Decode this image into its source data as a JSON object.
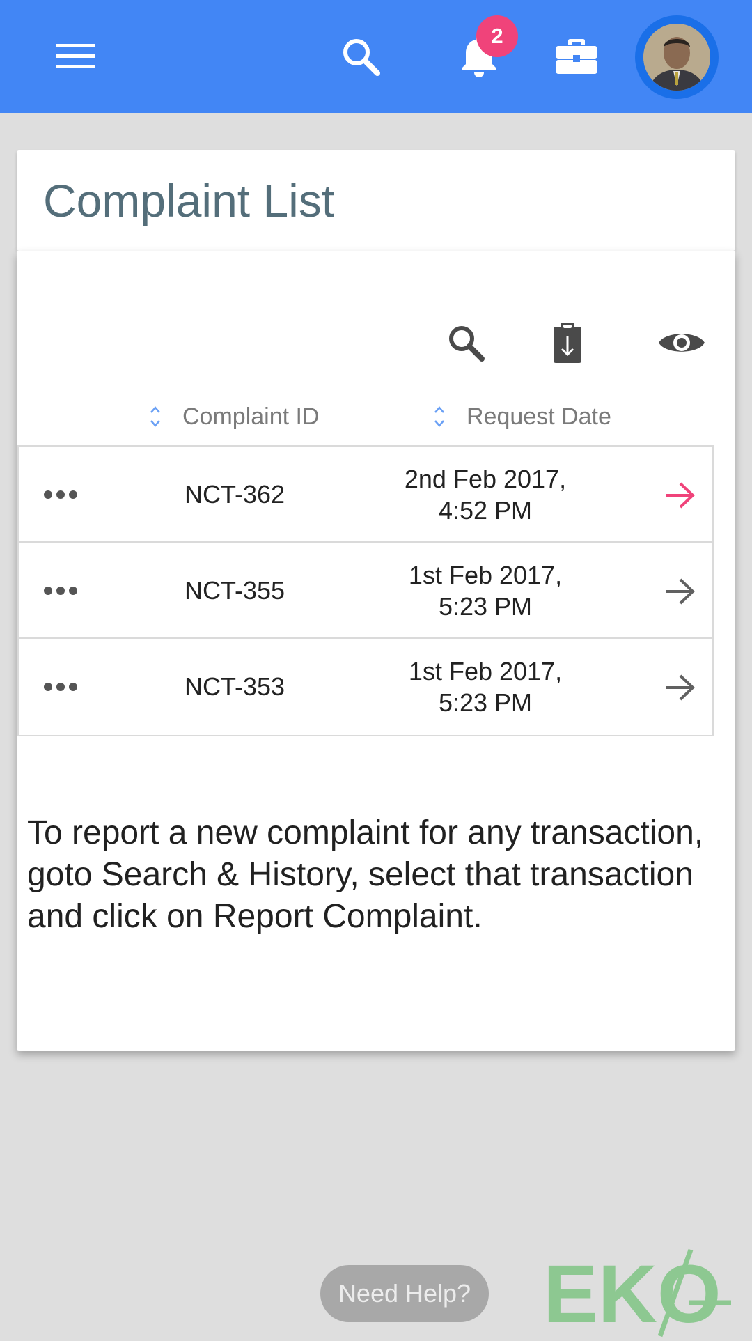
{
  "header": {
    "menu_icon": "hamburger-menu-icon",
    "search_icon": "search-icon",
    "notification_icon": "bell-icon",
    "notification_count": "2",
    "wallet_icon": "briefcase-icon",
    "avatar_icon": "user-avatar",
    "bar_color": "#4286f5",
    "badge_color": "#f0437a"
  },
  "page": {
    "title": "Complaint List"
  },
  "toolbar": {
    "search_icon": "search-icon",
    "export_icon": "clipboard-download-icon",
    "view_icon": "eye-icon"
  },
  "table": {
    "columns": [
      "Complaint ID",
      "Request Date"
    ],
    "rows": [
      {
        "id": "NCT-362",
        "date": "2nd Feb 2017, 4:52 PM",
        "arrow_color": "#f0437a"
      },
      {
        "id": "NCT-355",
        "date": "1st Feb 2017, 5:23 PM",
        "arrow_color": "#616161"
      },
      {
        "id": "NCT-353",
        "date": "1st Feb 2017, 5:23 PM",
        "arrow_color": "#616161"
      }
    ]
  },
  "info": {
    "text": "To report a new complaint for any transaction, goto Search & History, select that transaction and click on Report Complaint."
  },
  "footer": {
    "help_label": "Need Help?",
    "logo_text": "EKO",
    "logo_color": "#8dc891"
  }
}
